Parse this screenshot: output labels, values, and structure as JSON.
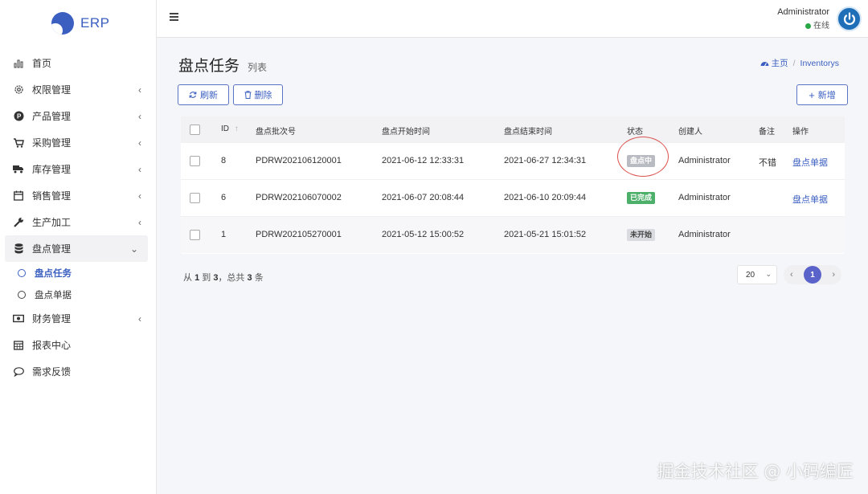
{
  "brand": {
    "name": "ERP"
  },
  "sidebar": {
    "items": [
      {
        "label": "首页",
        "icon": "bar-chart-icon",
        "has_children": false
      },
      {
        "label": "权限管理",
        "icon": "gear-icon",
        "has_children": true
      },
      {
        "label": "产品管理",
        "icon": "product-icon",
        "has_children": true
      },
      {
        "label": "采购管理",
        "icon": "cart-icon",
        "has_children": true
      },
      {
        "label": "库存管理",
        "icon": "truck-icon",
        "has_children": true
      },
      {
        "label": "销售管理",
        "icon": "calendar-icon",
        "has_children": true
      },
      {
        "label": "生产加工",
        "icon": "wrench-icon",
        "has_children": true
      },
      {
        "label": "盘点管理",
        "icon": "database-icon",
        "has_children": true,
        "open": true
      },
      {
        "label": "财务管理",
        "icon": "money-icon",
        "has_children": true
      },
      {
        "label": "报表中心",
        "icon": "calendar-grid-icon",
        "has_children": false
      },
      {
        "label": "需求反馈",
        "icon": "comment-icon",
        "has_children": false
      }
    ],
    "sub_items": [
      {
        "label": "盘点任务",
        "active": true
      },
      {
        "label": "盘点单据",
        "active": false
      }
    ]
  },
  "topbar": {
    "user_name": "Administrator",
    "status": "在线"
  },
  "page": {
    "title": "盘点任务",
    "subtitle": "列表",
    "breadcrumb": {
      "home": "主页",
      "current": "Inventorys"
    }
  },
  "toolbar": {
    "refresh_label": "刷新",
    "delete_label": "删除",
    "add_label": "新增"
  },
  "table": {
    "headers": {
      "id": "ID",
      "batch_no": "盘点批次号",
      "start_time": "盘点开始时间",
      "end_time": "盘点结束时间",
      "status": "状态",
      "creator": "创建人",
      "remark": "备注",
      "action": "操作"
    },
    "rows": [
      {
        "id": "8",
        "batch_no": "PDRW202106120001",
        "start_time": "2021-06-12 12:33:31",
        "end_time": "2021-06-27 12:34:31",
        "status": "盘点中",
        "creator": "Administrator",
        "remark": "不错",
        "action": "盘点单据"
      },
      {
        "id": "6",
        "batch_no": "PDRW202106070002",
        "start_time": "2021-06-07 20:08:44",
        "end_time": "2021-06-10 20:09:44",
        "status": "已完成",
        "creator": "Administrator",
        "remark": "",
        "action": "盘点单据"
      },
      {
        "id": "1",
        "batch_no": "PDRW202105270001",
        "start_time": "2021-05-12 15:00:52",
        "end_time": "2021-05-21 15:01:52",
        "status": "未开始",
        "creator": "Administrator",
        "remark": "",
        "action": ""
      }
    ]
  },
  "pagination": {
    "summary": {
      "from_label": "从",
      "from": "1",
      "to_label": "到",
      "to": "3",
      "total_label": "，总共",
      "total": "3",
      "unit": "条"
    },
    "page_size": "20",
    "current_page": "1"
  },
  "watermark": "掘金技术社区 @ 小码编匠"
}
